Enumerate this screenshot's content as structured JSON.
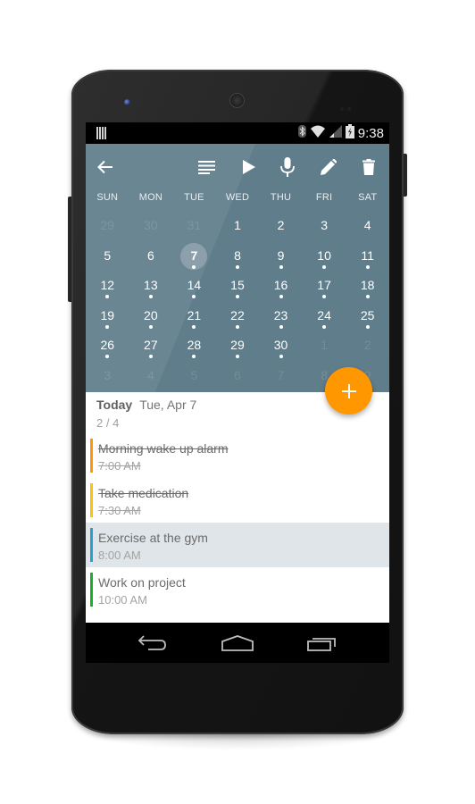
{
  "status_bar": {
    "time": "9:38",
    "icons": [
      "notification-barcode-icon",
      "bluetooth-icon",
      "wifi-icon",
      "signal-icon",
      "battery-charging-icon"
    ]
  },
  "toolbar": {
    "back": "arrow-back-icon",
    "actions": [
      "list-icon",
      "play-icon",
      "microphone-icon",
      "edit-pencil-icon",
      "delete-trash-icon"
    ]
  },
  "calendar": {
    "weekdays": [
      "SUN",
      "MON",
      "TUE",
      "WED",
      "THU",
      "FRI",
      "SAT"
    ],
    "today": "7",
    "weeks": [
      [
        {
          "d": "29",
          "m": true
        },
        {
          "d": "30",
          "m": true
        },
        {
          "d": "31",
          "m": true
        },
        {
          "d": "1"
        },
        {
          "d": "2"
        },
        {
          "d": "3"
        },
        {
          "d": "4"
        }
      ],
      [
        {
          "d": "5"
        },
        {
          "d": "6"
        },
        {
          "d": "7",
          "t": true,
          "e": true
        },
        {
          "d": "8",
          "e": true
        },
        {
          "d": "9",
          "e": true
        },
        {
          "d": "10",
          "e": true
        },
        {
          "d": "11",
          "e": true
        }
      ],
      [
        {
          "d": "12",
          "e": true
        },
        {
          "d": "13",
          "e": true
        },
        {
          "d": "14",
          "e": true
        },
        {
          "d": "15",
          "e": true
        },
        {
          "d": "16",
          "e": true
        },
        {
          "d": "17",
          "e": true
        },
        {
          "d": "18",
          "e": true
        }
      ],
      [
        {
          "d": "19",
          "e": true
        },
        {
          "d": "20",
          "e": true
        },
        {
          "d": "21",
          "e": true
        },
        {
          "d": "22",
          "e": true
        },
        {
          "d": "23",
          "e": true
        },
        {
          "d": "24",
          "e": true
        },
        {
          "d": "25",
          "e": true
        }
      ],
      [
        {
          "d": "26",
          "e": true
        },
        {
          "d": "27",
          "e": true
        },
        {
          "d": "28",
          "e": true
        },
        {
          "d": "29",
          "e": true
        },
        {
          "d": "30",
          "e": true
        },
        {
          "d": "1",
          "m": true
        },
        {
          "d": "2",
          "m": true
        }
      ],
      [
        {
          "d": "3",
          "m": true
        },
        {
          "d": "4",
          "m": true
        },
        {
          "d": "5",
          "m": true
        },
        {
          "d": "6",
          "m": true
        },
        {
          "d": "7",
          "m": true
        },
        {
          "d": "8",
          "m": true
        },
        {
          "d": "9",
          "m": true
        }
      ]
    ],
    "accent_color": "#607d8b"
  },
  "fab": {
    "icon": "plus-icon",
    "color": "#ff9800"
  },
  "list": {
    "today_label": "Today",
    "date_label": "Tue, Apr 7",
    "progress": "2 / 4",
    "items": [
      {
        "title": "Morning wake up alarm",
        "time": "7:00 AM",
        "done": true,
        "selected": false,
        "color": "#ff9800"
      },
      {
        "title": "Take medication",
        "time": "7:30 AM",
        "done": true,
        "selected": false,
        "color": "#ffc107"
      },
      {
        "title": "Exercise at the gym",
        "time": "8:00 AM",
        "done": false,
        "selected": true,
        "color": "#29a0c9"
      },
      {
        "title": "Work on project",
        "time": "10:00 AM",
        "done": false,
        "selected": false,
        "color": "#1aaf2a"
      }
    ]
  },
  "nav_bar": {
    "buttons": [
      "back-icon",
      "home-icon",
      "recent-apps-icon"
    ]
  }
}
